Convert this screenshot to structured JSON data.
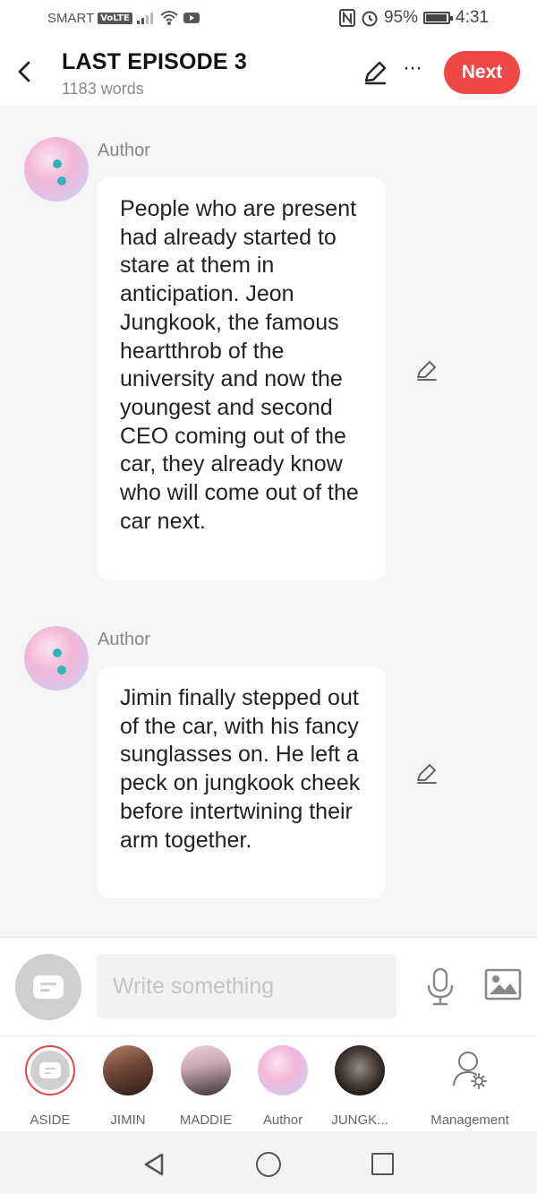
{
  "status_bar": {
    "carrier": "SMART",
    "volte": "VoLTE",
    "battery_percent": "95%",
    "battery_level": 0.95,
    "time": "4:31",
    "icons": [
      "signal-icon",
      "wifi-icon",
      "youtube-icon",
      "nfc-icon",
      "alarm-icon",
      "battery-icon"
    ]
  },
  "header": {
    "title": "LAST EPISODE 3",
    "word_count": "1183 words",
    "next_label": "Next",
    "more_label": "···",
    "accent_color": "#f04747"
  },
  "messages": [
    {
      "author": "Author",
      "text": "People who are present had already started to stare at them in anticipation. Jeon Jungkook, the famous heartthrob of the university and now the youngest and second CEO coming out of the car, they already know who will come out of the car next."
    },
    {
      "author": "Author",
      "text": "Jimin finally stepped out of the car, with his fancy sunglasses on. He left a peck on jungkook cheek before intertwining their arm together."
    }
  ],
  "composer": {
    "placeholder": "Write something"
  },
  "roles": [
    {
      "label": "ASIDE",
      "selected": true
    },
    {
      "label": "JIMIN",
      "selected": false
    },
    {
      "label": "MADDIE",
      "selected": false
    },
    {
      "label": "Author",
      "selected": false
    },
    {
      "label": "JUNGK...",
      "selected": false
    },
    {
      "label": "Management",
      "selected": false
    }
  ]
}
